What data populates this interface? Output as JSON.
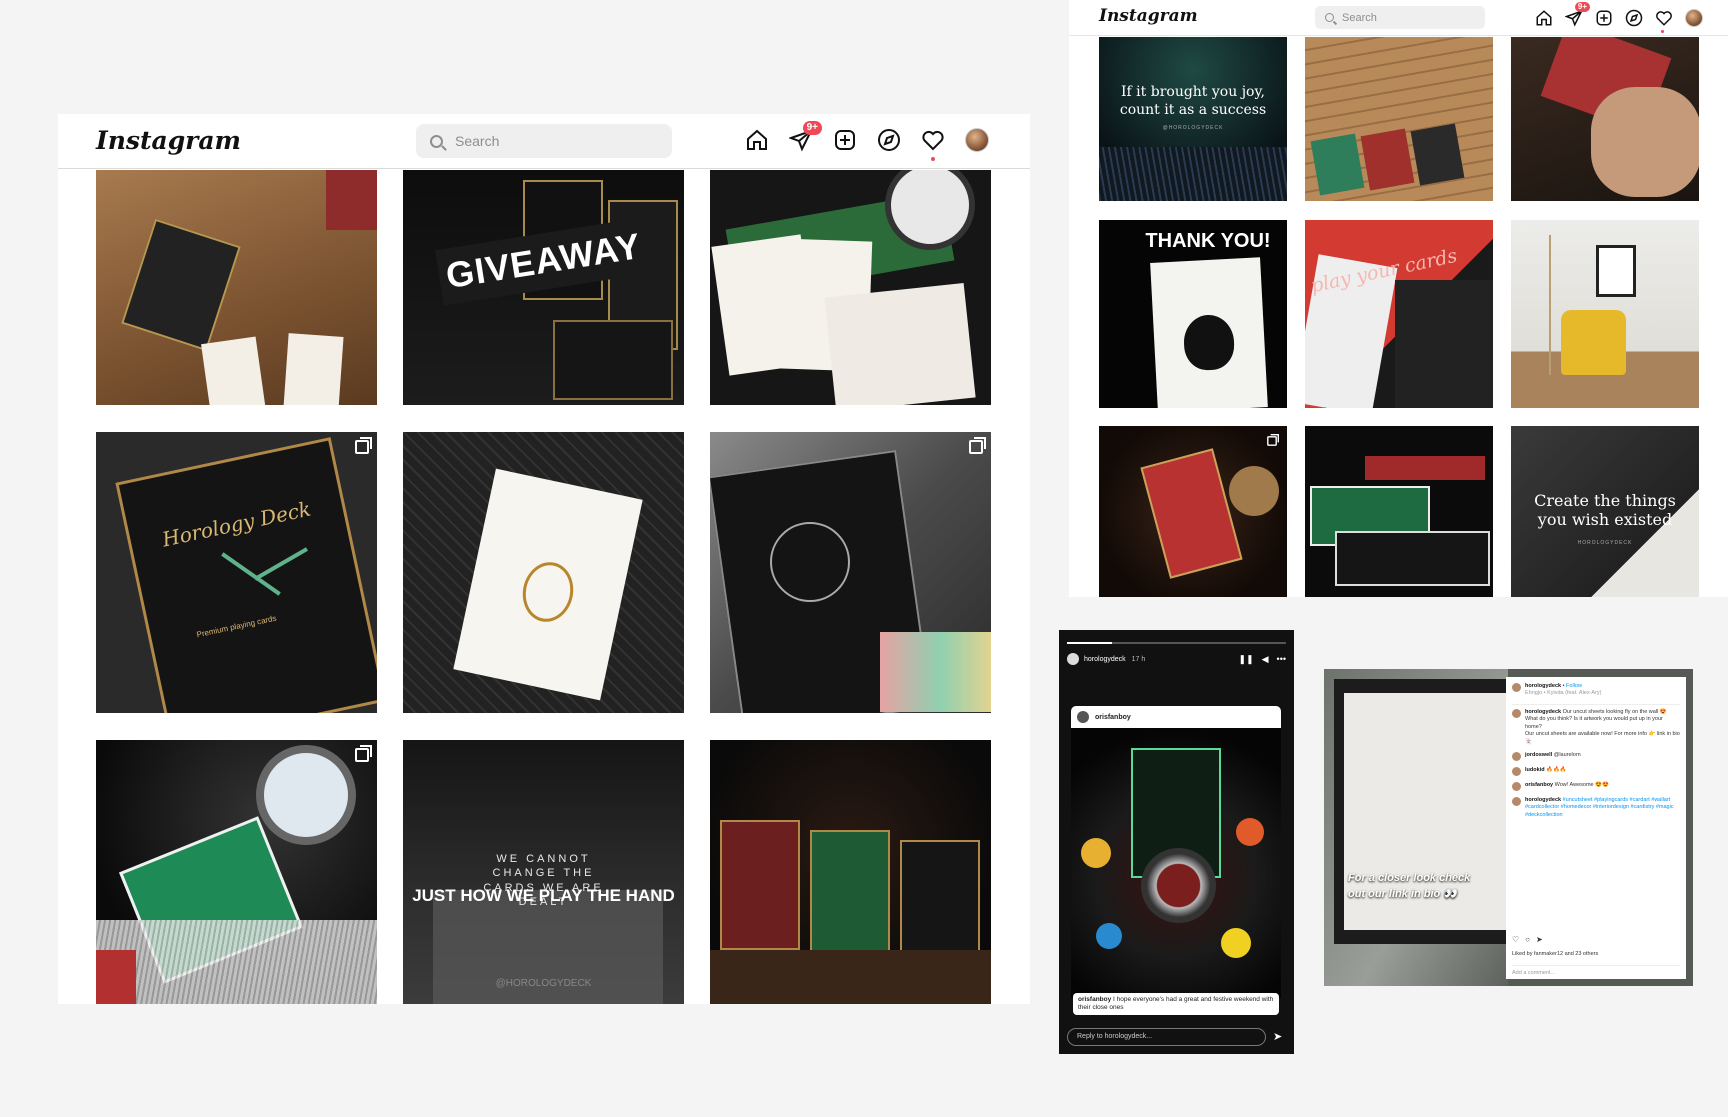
{
  "app": {
    "logo": "Instagram",
    "search_placeholder": "Search",
    "messages_badge": "9+"
  },
  "grid_main": {
    "tiles": [
      {
        "label": ""
      },
      {
        "label": "GIVEAWAY"
      },
      {
        "label": ""
      },
      {
        "label": "Horology Deck",
        "sub": "Premium playing cards"
      },
      {
        "label": ""
      },
      {
        "label": ""
      },
      {
        "label": ""
      },
      {
        "label": "WE CANNOT CHANGE THE CARDS WE ARE DEALT",
        "sub": "JUST HOW WE PLAY THE HAND",
        "handle": "@HOROLOGYDECK"
      },
      {
        "label": ""
      }
    ]
  },
  "grid_secondary": {
    "tiles": [
      {
        "label": "If it brought you joy, count it as a success",
        "handle": "@HOROLOGYDECK"
      },
      {
        "label": ""
      },
      {
        "label": ""
      },
      {
        "label": "THANK YOU!"
      },
      {
        "label": "play your cards"
      },
      {
        "label": ""
      },
      {
        "label": ""
      },
      {
        "label": ""
      },
      {
        "label": "Create the things you wish existed",
        "handle": "HOROLOGYDECK"
      }
    ]
  },
  "story": {
    "username": "horologydeck",
    "time": "17 h",
    "card_user": "orisfanboy",
    "comment_user": "orisfanboy",
    "comment_text": "I hope everyone's had a great and festive weekend with their close ones",
    "reply_placeholder": "Reply to horologydeck..."
  },
  "post": {
    "cta_line1": "For a closer look check",
    "cta_line2": "out our link in bio 👀",
    "author": "horologydeck",
    "follow": "Follow",
    "location": "Ehngjo • Kyivda (feat. Alex-Ary)",
    "caption": "Our uncut sheets looking fly on the wall 😍 What do you think? Is it artwork you would put up in your home?",
    "caption2": "Our uncut sheets are available now! For more info 👉 link in bio 🃏",
    "comments": [
      {
        "user": "jordoswell",
        "text": "@laurelorn"
      },
      {
        "user": "ludokid",
        "text": "🔥🔥🔥"
      },
      {
        "user": "orisfanboy",
        "text": "Wow! Awesome 😍😍"
      }
    ],
    "hashtags": "#uncutsheet #playingcards #cardart #wallart #cardcollector #homedecor #interiordesign #cardistry #magic #deckcollection",
    "liked_by": "Liked by fanmaker12 and 23 others",
    "add_comment": "Add a comment..."
  },
  "colors": {
    "accent_red": "#ed4956",
    "link_blue": "#0095f6"
  }
}
